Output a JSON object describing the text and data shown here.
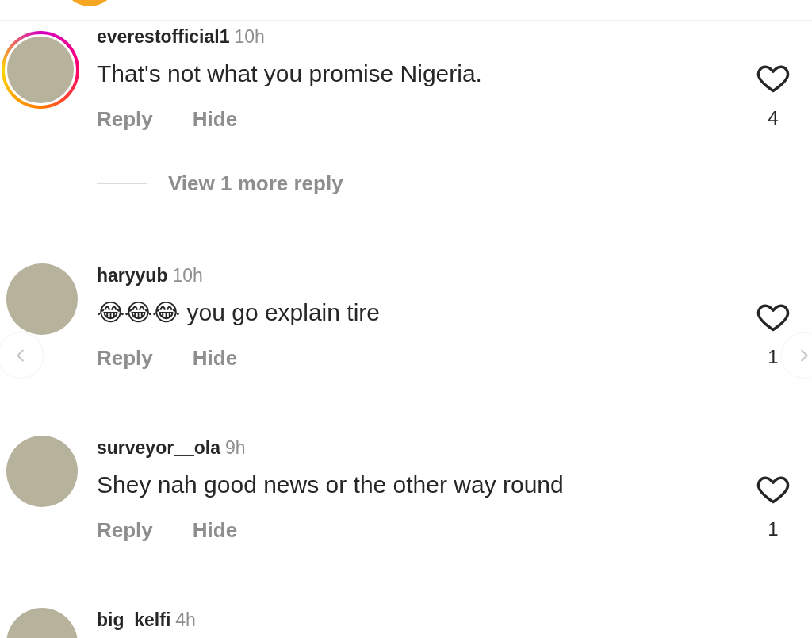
{
  "comments": [
    {
      "username": "everestofficial1",
      "time": "10h",
      "text": "That's not what you promise Nigeria.",
      "story_ring": true,
      "liked": false,
      "likes": "4",
      "actions": [
        "Reply",
        "Hide"
      ],
      "view_replies": "View 1 more reply"
    },
    {
      "username": "haryyub",
      "time": "10h",
      "text": "😂😂😂 you go explain tire",
      "story_ring": false,
      "liked": false,
      "likes": "1",
      "actions": [
        "Reply",
        "Hide"
      ]
    },
    {
      "username": "surveyor__ola",
      "time": "9h",
      "text": "Shey nah good news or the other way round",
      "story_ring": false,
      "liked": false,
      "likes": "1",
      "actions": [
        "Reply",
        "Hide"
      ]
    },
    {
      "username": "big_kelfi",
      "time": "4h",
      "story_ring": false
    }
  ]
}
